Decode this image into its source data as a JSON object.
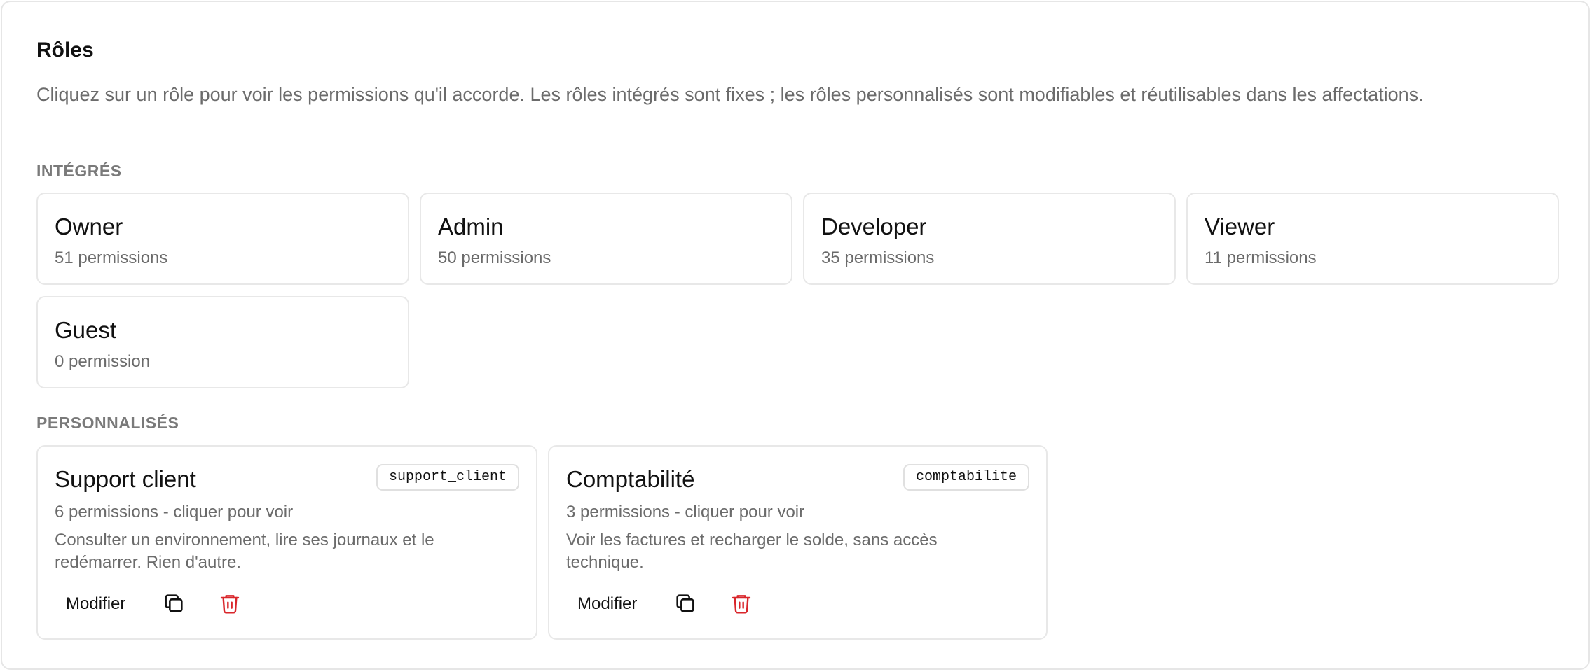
{
  "header": {
    "title": "Rôles",
    "description": "Cliquez sur un rôle pour voir les permissions qu'il accorde. Les rôles intégrés sont fixes ; les rôles personnalisés sont modifiables et réutilisables dans les affectations."
  },
  "builtin": {
    "label": "INTÉGRÉS",
    "roles": [
      {
        "name": "Owner",
        "count": "51 permissions"
      },
      {
        "name": "Admin",
        "count": "50 permissions"
      },
      {
        "name": "Developer",
        "count": "35 permissions"
      },
      {
        "name": "Viewer",
        "count": "11 permissions"
      },
      {
        "name": "Guest",
        "count": "0 permission"
      }
    ]
  },
  "custom": {
    "label": "PERSONNALISÉS",
    "roles": [
      {
        "name": "Support client",
        "slug": "support_client",
        "count": "6 permissions - cliquer pour voir",
        "description": "Consulter un environnement, lire ses journaux et le redémarrer. Rien d'autre.",
        "edit_label": "Modifier"
      },
      {
        "name": "Comptabilité",
        "slug": "comptabilite",
        "count": "3 permissions - cliquer pour voir",
        "description": "Voir les factures et recharger le solde, sans accès technique.",
        "edit_label": "Modifier"
      }
    ]
  },
  "icons": {
    "duplicate": "copy-icon",
    "delete": "trash-icon"
  },
  "colors": {
    "danger": "#d9262b",
    "muted": "#6b6b6b",
    "border": "#e8e8e8"
  }
}
